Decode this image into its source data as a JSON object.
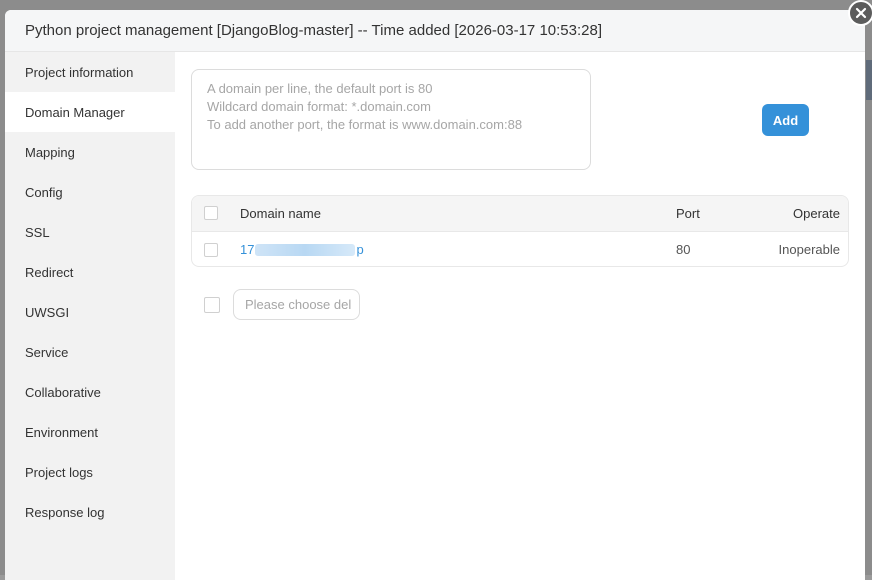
{
  "modal": {
    "title": "Python project management [DjangoBlog-master] -- Time added [2026-03-17 10:53:28]"
  },
  "sidebar": {
    "items": [
      {
        "label": "Project information"
      },
      {
        "label": "Domain Manager",
        "active": true
      },
      {
        "label": "Mapping"
      },
      {
        "label": "Config"
      },
      {
        "label": "SSL"
      },
      {
        "label": "Redirect"
      },
      {
        "label": "UWSGI"
      },
      {
        "label": "Service"
      },
      {
        "label": "Collaborative"
      },
      {
        "label": "Environment"
      },
      {
        "label": "Project logs"
      },
      {
        "label": "Response log"
      }
    ]
  },
  "domain_input": {
    "placeholder": "A domain per line, the default port is 80\nWildcard domain format: *.domain.com\nTo add another port, the format is www.domain.com:88",
    "value": ""
  },
  "add_button": {
    "label": "Add"
  },
  "table": {
    "headers": {
      "domain": "Domain name",
      "port": "Port",
      "operate": "Operate"
    },
    "rows": [
      {
        "domain_prefix": "17",
        "domain_suffix": "p",
        "port": "80",
        "operate": "Inoperable"
      }
    ]
  },
  "batch": {
    "placeholder": "Please choose del"
  },
  "colors": {
    "accent": "#3491d9",
    "sidebar_bg": "#f2f2f2",
    "header_bg": "#f5f6f7"
  },
  "icons": {
    "close": "close-icon"
  }
}
